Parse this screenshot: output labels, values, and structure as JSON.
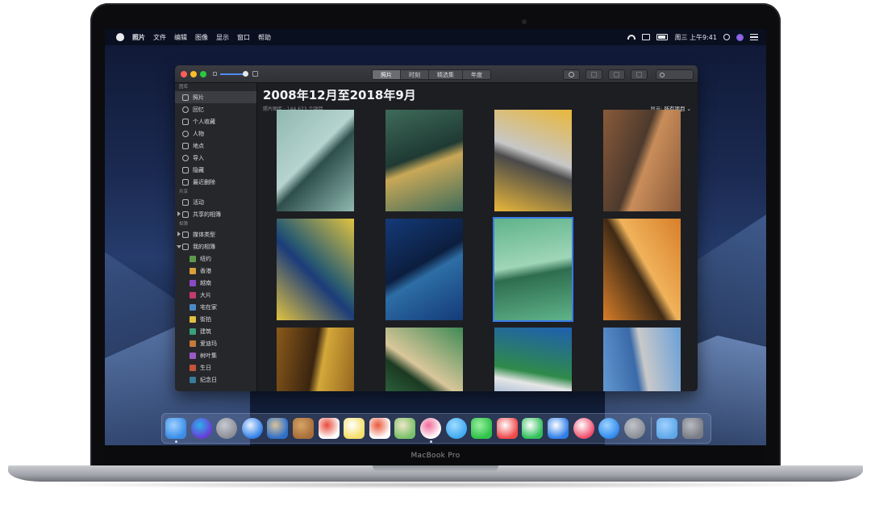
{
  "menubar": {
    "app_name": "照片",
    "items": [
      "文件",
      "编辑",
      "图像",
      "显示",
      "窗口",
      "帮助"
    ],
    "clock": "周三 上午9:41"
  },
  "toolbar": {
    "tabs": [
      {
        "label": "照片",
        "active": true
      },
      {
        "label": "时刻",
        "active": false
      },
      {
        "label": "精选集",
        "active": false
      },
      {
        "label": "年度",
        "active": false
      }
    ],
    "zoom_level": 0.9
  },
  "sidebar": {
    "sections": [
      {
        "header": "图库",
        "items": [
          {
            "label": "照片",
            "icon": "photos-grid-icon",
            "selected": true
          },
          {
            "label": "回忆",
            "icon": "memories-icon"
          },
          {
            "label": "个人收藏",
            "icon": "heart-icon"
          },
          {
            "label": "人物",
            "icon": "person-icon"
          },
          {
            "label": "地点",
            "icon": "pin-icon"
          },
          {
            "label": "导入",
            "icon": "import-icon"
          },
          {
            "label": "隐藏",
            "icon": "hidden-icon"
          },
          {
            "label": "最近删除",
            "icon": "trash-icon"
          }
        ]
      },
      {
        "header": "共享",
        "items": [
          {
            "label": "活动",
            "icon": "cloud-icon"
          },
          {
            "label": "共享的相簿",
            "icon": "shared-album-icon",
            "disclosure": "closed"
          }
        ]
      },
      {
        "header": "相簿",
        "items": [
          {
            "label": "媒体类型",
            "icon": "folder-icon",
            "disclosure": "closed"
          },
          {
            "label": "我的相簿",
            "icon": "folder-icon",
            "disclosure": "open"
          },
          {
            "label": "纽约",
            "icon": "album-thumb",
            "sub": true
          },
          {
            "label": "香港",
            "icon": "album-thumb",
            "sub": true
          },
          {
            "label": "越南",
            "icon": "album-thumb",
            "sub": true
          },
          {
            "label": "大片",
            "icon": "album-thumb",
            "sub": true
          },
          {
            "label": "宅在家",
            "icon": "album-thumb",
            "sub": true
          },
          {
            "label": "街拍",
            "icon": "album-thumb",
            "sub": true
          },
          {
            "label": "建筑",
            "icon": "album-thumb",
            "sub": true
          },
          {
            "label": "爱迪玛",
            "icon": "album-thumb",
            "sub": true
          },
          {
            "label": "树叶集",
            "icon": "album-thumb",
            "sub": true
          },
          {
            "label": "生日",
            "icon": "album-thumb",
            "sub": true
          },
          {
            "label": "纪念日",
            "icon": "album-thumb",
            "sub": true
          }
        ]
      }
    ]
  },
  "main": {
    "title": "2008年12月至2018年9月",
    "subtitle": "照片图库 · 144,673 个项目",
    "filter_label": "显示:",
    "filter_value": "所有项目 ⌄",
    "photos": [
      {
        "name": "photo-teal-lamp",
        "colors": [
          "#8fb8b0",
          "#2e4f4c",
          "#b7d4cf"
        ],
        "selected": false
      },
      {
        "name": "photo-green-wedge",
        "colors": [
          "#3e6b5a",
          "#c9a857",
          "#1f3a33"
        ],
        "selected": false
      },
      {
        "name": "photo-shadow-yellow",
        "colors": [
          "#e9b73a",
          "#4a4a4a",
          "#c7c7c7"
        ],
        "selected": false
      },
      {
        "name": "photo-rust-rainbow",
        "colors": [
          "#8a5a3a",
          "#c98d5a",
          "#4d3a2d"
        ],
        "selected": false
      },
      {
        "name": "photo-yellow-zigzag",
        "colors": [
          "#e1c341",
          "#2e5f6f",
          "#1b3c7a"
        ],
        "selected": false
      },
      {
        "name": "photo-teal-object",
        "colors": [
          "#143a78",
          "#2d6ea5",
          "#0c1e3f"
        ],
        "selected": false
      },
      {
        "name": "photo-green-pool",
        "colors": [
          "#5fb38a",
          "#2e6d4e",
          "#9fd6b8"
        ],
        "selected": true
      },
      {
        "name": "photo-orange-steps",
        "colors": [
          "#d87f2a",
          "#f0b25a",
          "#3f2a15"
        ],
        "selected": false
      },
      {
        "name": "photo-wood-yellow",
        "colors": [
          "#8a5a1a",
          "#d4a83a",
          "#3a2410"
        ],
        "selected": false
      },
      {
        "name": "photo-green-diagonal",
        "colors": [
          "#3f8a55",
          "#d9c79a",
          "#1b3a22"
        ],
        "selected": false
      },
      {
        "name": "photo-building-blue",
        "colors": [
          "#1f5fb0",
          "#e6e6e6",
          "#2f8a4a"
        ],
        "selected": false
      },
      {
        "name": "photo-horse-statue",
        "colors": [
          "#6aa0d8",
          "#c9c9c9",
          "#3a6aa8"
        ],
        "selected": false
      }
    ]
  },
  "dock": {
    "apps": [
      {
        "name": "finder",
        "color": "#3b8ee8",
        "color2": "#9fd0ff",
        "running": true
      },
      {
        "name": "siri",
        "color": "#6a3ad8",
        "color2": "#2fb0e8",
        "running": false
      },
      {
        "name": "launchpad",
        "color": "#8a8d95",
        "color2": "#c7cad1",
        "running": false
      },
      {
        "name": "safari",
        "color": "#2f7ee8",
        "color2": "#e8f2ff",
        "running": false
      },
      {
        "name": "mail-stamp",
        "color": "#2f6fc8",
        "color2": "#d8c49a",
        "running": false
      },
      {
        "name": "contacts",
        "color": "#a86f3a",
        "color2": "#d7a466",
        "running": false
      },
      {
        "name": "calendar",
        "color": "#ffffff",
        "color2": "#e84a3a",
        "running": false
      },
      {
        "name": "notes",
        "color": "#f5df6a",
        "color2": "#ffffff",
        "running": false
      },
      {
        "name": "reminders",
        "color": "#ffffff",
        "color2": "#e8583a",
        "running": false
      },
      {
        "name": "maps",
        "color": "#7ac16a",
        "color2": "#f0e6c8",
        "running": false
      },
      {
        "name": "photos",
        "color": "#ffffff",
        "color2": "#f06a9a",
        "running": true
      },
      {
        "name": "messages",
        "color": "#3fa8f0",
        "color2": "#9fdcff",
        "running": false
      },
      {
        "name": "facetime",
        "color": "#2fc24a",
        "color2": "#9af0a0",
        "running": false
      },
      {
        "name": "news",
        "color": "#f04a4a",
        "color2": "#ffffff",
        "running": false
      },
      {
        "name": "numbers",
        "color": "#2fbf5a",
        "color2": "#ffffff",
        "running": false
      },
      {
        "name": "keynote",
        "color": "#2f7ee8",
        "color2": "#ffffff",
        "running": false
      },
      {
        "name": "music",
        "color": "#f04a6a",
        "color2": "#ffffff",
        "running": false
      },
      {
        "name": "app-store",
        "color": "#2f8af0",
        "color2": "#9fd4ff",
        "running": false
      },
      {
        "name": "system-preferences",
        "color": "#8a8d95",
        "color2": "#c0c3ca",
        "running": false
      }
    ],
    "trailing": [
      {
        "name": "downloads-folder",
        "color": "#5fa8e8",
        "color2": "#9fd0ff"
      },
      {
        "name": "trash",
        "color": "#7a7d85",
        "color2": "#b8bbc2"
      }
    ]
  },
  "device": {
    "model": "MacBook Pro"
  }
}
